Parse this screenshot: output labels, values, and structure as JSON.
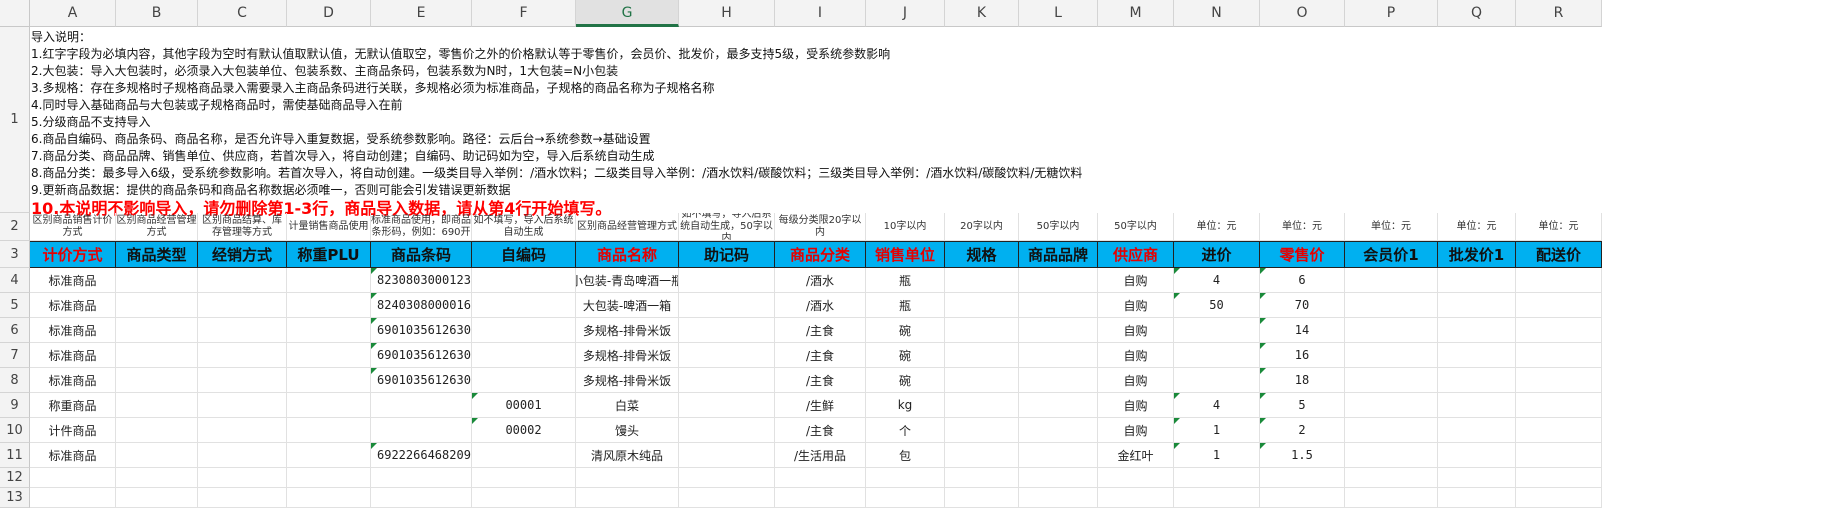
{
  "columns": [
    "A",
    "B",
    "C",
    "D",
    "E",
    "F",
    "G",
    "H",
    "I",
    "J",
    "K",
    "L",
    "M",
    "N",
    "O",
    "P",
    "Q",
    "R"
  ],
  "selected_column": "G",
  "row_numbers": [
    "1",
    "2",
    "3",
    "4",
    "5",
    "6",
    "7",
    "8",
    "9",
    "10",
    "11",
    "12",
    "13"
  ],
  "notes": {
    "lines": [
      "导入说明：",
      "1.红字字段为必填内容，其他字段为空时有默认值取默认值，无默认值取空，零售价之外的价格默认等于零售价，会员价、批发价，最多支持5级，受系统参数影响",
      "2.大包装：导入大包装时，必须录入大包装单位、包装系数、主商品条码，包装系数为N时，1大包装=N小包装",
      "3.多规格：存在多规格时子规格商品录入需要录入主商品条码进行关联，多规格必须为标准商品，子规格的商品名称为子规格名称",
      "4.同时导入基础商品与大包装或子规格商品时，需使基础商品导入在前",
      "5.分级商品不支持导入",
      "6.商品自编码、商品条码、商品名称，是否允许导入重复数据，受系统参数影响。路径：云后台→系统参数→基础设置",
      "7.商品分类、商品品牌、销售单位、供应商，若首次导入，将自动创建；自编码、助记码如为空，导入后系统自动生成",
      "8.商品分类：最多导入6级，受系统参数影响。若首次导入，将自动创建。一级类目导入举例：/酒水饮料；二级类目导入举例：/酒水饮料/碳酸饮料；三级类目导入举例：/酒水饮料/碳酸饮料/无糖饮料",
      "9.更新商品数据：提供的商品条码和商品名称数据必须唯一，否则可能会引发错误更新数据"
    ],
    "warning": "10.本说明不影响导入，请勿删除第1-3行，商品导入数据，请从第4行开始填写。"
  },
  "hints": [
    "区别商品销售计价方式",
    "区别商品经营管理方式",
    "区别商品结算、库存管理等方式",
    "计量销售商品使用",
    "标准商品使用，即商品条形码，例如：690开",
    "如不填写，导入后系统自动生成",
    "区别商品经营管理方式",
    "如不填写，导入后系统自动生成，50字以内",
    "每级分类限20字以内",
    "10字以内",
    "20字以内",
    "50字以内",
    "50字以内",
    "单位：元",
    "单位：元",
    "单位：元",
    "单位：元",
    "单位：元"
  ],
  "headers": [
    {
      "label": "计价方式",
      "required": true
    },
    {
      "label": "商品类型",
      "required": false
    },
    {
      "label": "经销方式",
      "required": false
    },
    {
      "label": "称重PLU",
      "required": false
    },
    {
      "label": "商品条码",
      "required": false
    },
    {
      "label": "自编码",
      "required": false
    },
    {
      "label": "商品名称",
      "required": true
    },
    {
      "label": "助记码",
      "required": false
    },
    {
      "label": "商品分类",
      "required": true
    },
    {
      "label": "销售单位",
      "required": true
    },
    {
      "label": "规格",
      "required": false
    },
    {
      "label": "商品品牌",
      "required": false
    },
    {
      "label": "供应商",
      "required": true
    },
    {
      "label": "进价",
      "required": false
    },
    {
      "label": "零售价",
      "required": true
    },
    {
      "label": "会员价1",
      "required": false
    },
    {
      "label": "批发价1",
      "required": false
    },
    {
      "label": "配送价",
      "required": false
    }
  ],
  "rows": [
    {
      "pricing": "标准商品",
      "barcode": "8230803000123",
      "code": "",
      "name": "小包装-青岛啤酒一瓶",
      "category": "/酒水",
      "unit": "瓶",
      "supplier": "自购",
      "cost": "4",
      "retail": "6"
    },
    {
      "pricing": "标准商品",
      "barcode": "8240308000016",
      "code": "",
      "name": "大包装-啤酒一箱",
      "category": "/酒水",
      "unit": "瓶",
      "supplier": "自购",
      "cost": "50",
      "retail": "70"
    },
    {
      "pricing": "标准商品",
      "barcode": "6901035612630",
      "code": "",
      "name": "多规格-排骨米饭",
      "category": "/主食",
      "unit": "碗",
      "supplier": "自购",
      "cost": "",
      "retail": "14"
    },
    {
      "pricing": "标准商品",
      "barcode": "6901035612630",
      "code": "",
      "name": "多规格-排骨米饭",
      "category": "/主食",
      "unit": "碗",
      "supplier": "自购",
      "cost": "",
      "retail": "16"
    },
    {
      "pricing": "标准商品",
      "barcode": "6901035612630",
      "code": "",
      "name": "多规格-排骨米饭",
      "category": "/主食",
      "unit": "碗",
      "supplier": "自购",
      "cost": "",
      "retail": "18"
    },
    {
      "pricing": "称重商品",
      "barcode": "",
      "code": "00001",
      "name": "白菜",
      "category": "/生鲜",
      "unit": "kg",
      "supplier": "自购",
      "cost": "4",
      "retail": "5"
    },
    {
      "pricing": "计件商品",
      "barcode": "",
      "code": "00002",
      "name": "馒头",
      "category": "/主食",
      "unit": "个",
      "supplier": "自购",
      "cost": "1",
      "retail": "2"
    },
    {
      "pricing": "标准商品",
      "barcode": "6922266468209",
      "code": "",
      "name": "清风原木纯品",
      "category": "/生活用品",
      "unit": "包",
      "supplier": "金红叶",
      "cost": "1",
      "retail": "1.5"
    }
  ],
  "colors": {
    "header_fill": "#00b0f0",
    "required_text": "#e60000",
    "selection": "#217346"
  }
}
